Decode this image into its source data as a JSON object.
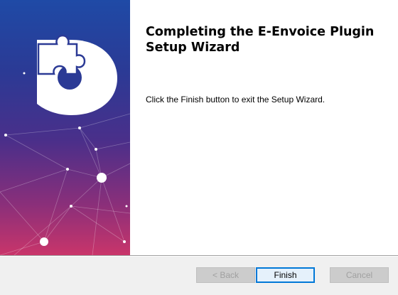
{
  "window": {
    "title_heading": "Completing the E-Envoice Plugin Setup Wizard",
    "message": "Click the Finish button to exit the Setup Wizard."
  },
  "buttons": {
    "back_label": "< Back",
    "finish_label": "Finish",
    "cancel_label": "Cancel",
    "back_enabled": false,
    "finish_default": true,
    "cancel_enabled": false
  },
  "banner": {
    "logo_icon": "puzzle-d-logo-icon",
    "gradient_top": "#1f4aa6",
    "gradient_bottom": "#c9356a"
  }
}
